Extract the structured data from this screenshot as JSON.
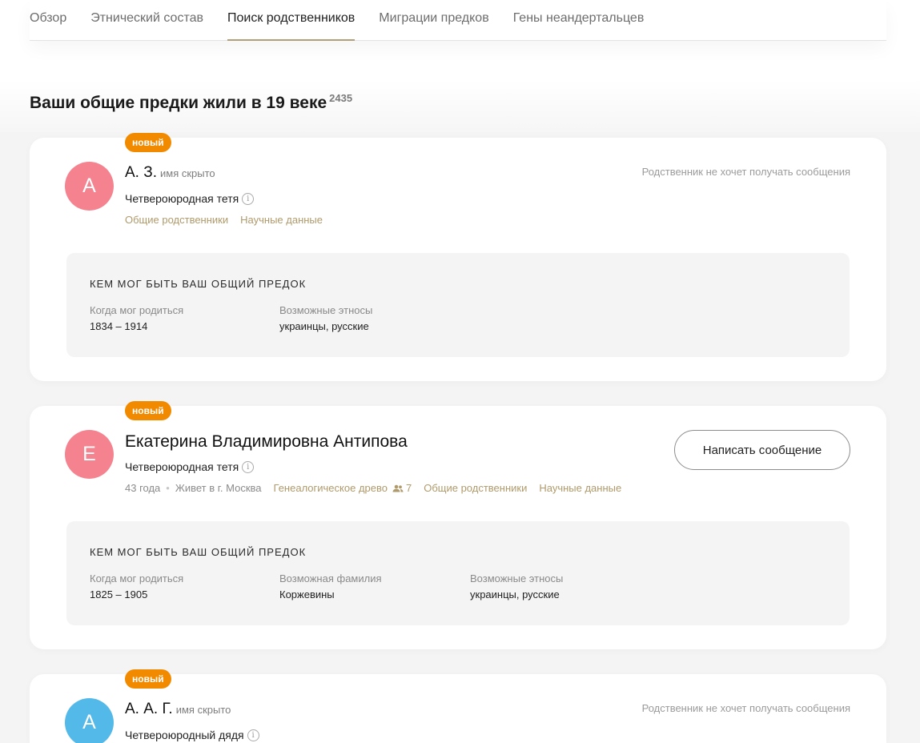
{
  "tabs": [
    {
      "label": "Обзор"
    },
    {
      "label": "Этнический состав"
    },
    {
      "label": "Поиск родственников"
    },
    {
      "label": "Миграции предков"
    },
    {
      "label": "Гены неандертальцев"
    }
  ],
  "section": {
    "title": "Ваши общие предки жили в 19 веке",
    "count": "2435"
  },
  "colors": {
    "accent": "#b09a6b",
    "badge": "#f28a00",
    "avatar_pink": "#f5838f",
    "avatar_blue": "#52b9e8"
  },
  "cards": [
    {
      "badge": "новый",
      "initial": "А",
      "name": "А. З.",
      "hidden_note": "имя скрыто",
      "relation": "Четвероюродная тетя",
      "links": [
        "Общие родственники",
        "Научные данные"
      ],
      "no_message": "Родственник не хочет получать сообщения",
      "ancestor": {
        "title": "КЕМ МОГ БЫТЬ ВАШ ОБЩИЙ ПРЕДОК",
        "born_label": "Когда мог родиться",
        "born_value": "1834 – 1914",
        "ethnos_label": "Возможные этносы",
        "ethnos_value": "украинцы, русские"
      }
    },
    {
      "badge": "новый",
      "initial": "Е",
      "name": "Екатерина Владимировна Антипова",
      "relation": "Четвероюродная тетя",
      "age": "43 года",
      "location": "Живет в г. Москва",
      "tree_link": "Генеалогическое древо",
      "tree_count": "7",
      "links": [
        "Общие родственники",
        "Научные данные"
      ],
      "message_button": "Написать сообщение",
      "ancestor": {
        "title": "КЕМ МОГ БЫТЬ ВАШ ОБЩИЙ ПРЕДОК",
        "born_label": "Когда мог родиться",
        "born_value": "1825 – 1905",
        "surname_label": "Возможная фамилия",
        "surname_value": "Коржевины",
        "ethnos_label": "Возможные этносы",
        "ethnos_value": "украинцы, русские"
      }
    },
    {
      "badge": "новый",
      "initial": "А",
      "name": "А. А. Г.",
      "hidden_note": "имя скрыто",
      "relation": "Четвероюродный дядя",
      "no_message": "Родственник не хочет получать сообщения"
    }
  ]
}
